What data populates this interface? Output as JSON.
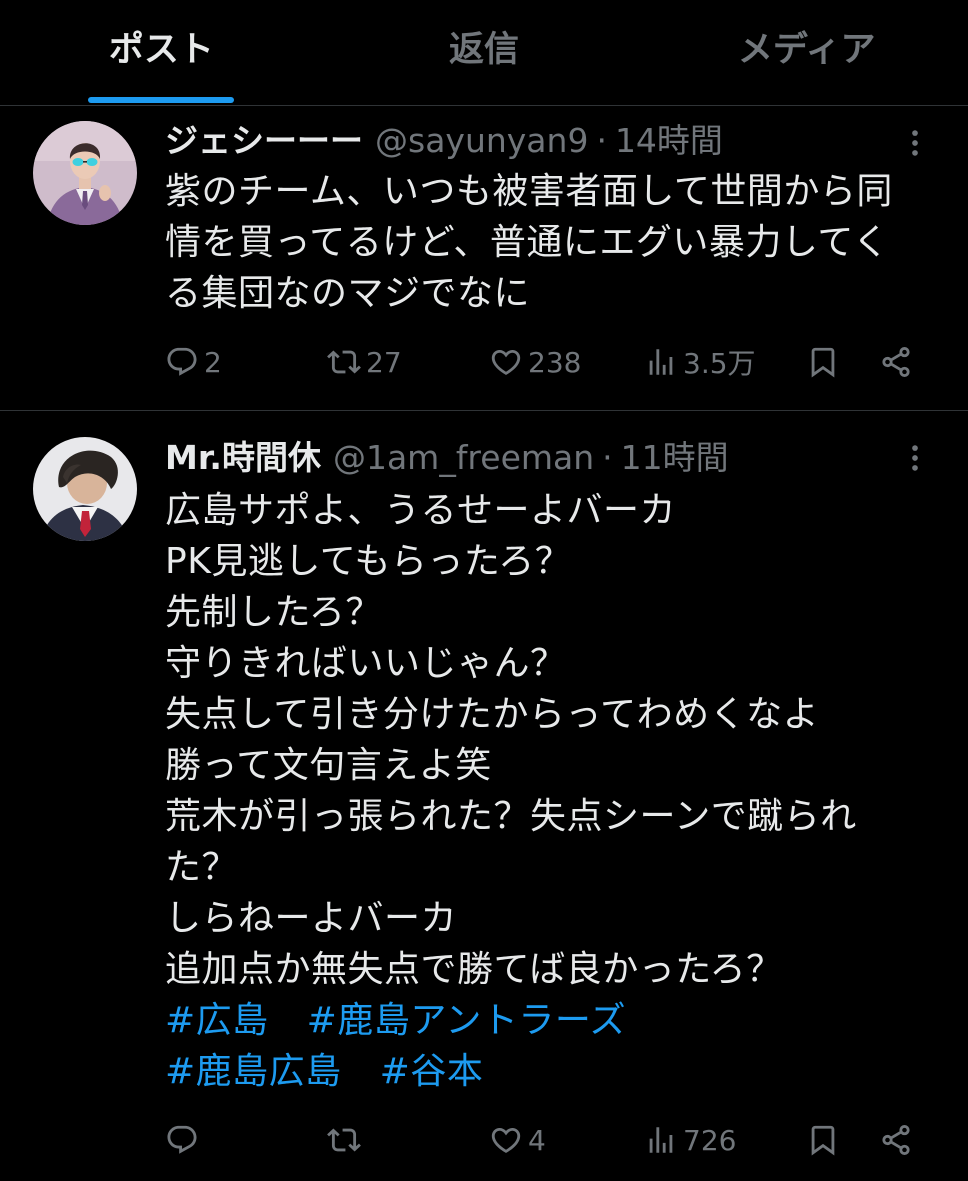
{
  "colors": {
    "background": "#000000",
    "text_primary": "#e7e9ea",
    "text_secondary": "#71767b",
    "accent": "#1d9bf0",
    "divider": "#2f3336"
  },
  "icons": {
    "reply": "reply-icon",
    "repost": "repost-icon",
    "like": "heart-icon",
    "views": "views-chart-icon",
    "bookmark": "bookmark-icon",
    "share": "share-icon",
    "more": "more-vertical-icon"
  },
  "tabs": [
    {
      "label": "ポスト",
      "active": true
    },
    {
      "label": "返信",
      "active": false
    },
    {
      "label": "メディア",
      "active": false
    }
  ],
  "posts": [
    {
      "display_name": "ジェシーーー",
      "handle": "@sayunyan9",
      "separator": "·",
      "time": "14時間",
      "text_lines": [
        "紫のチーム、いつも被害者面して世間から同",
        "情を買ってるけど、普通にエグい暴力してく",
        "る集団なのマジでなに"
      ],
      "stats": {
        "replies": "2",
        "reposts": "27",
        "likes": "238",
        "views": "3.5万"
      }
    },
    {
      "display_name": "Mr.時間休",
      "handle": "@1am_freeman",
      "separator": "·",
      "time": "11時間",
      "text_lines": [
        "広島サポよ、うるせーよバーカ",
        "PK見逃してもらったろ？",
        "先制したろ？",
        "守りきればいいじゃん？",
        "失点して引き分けたからってわめくなよ",
        "勝って文句言えよ笑",
        "荒木が引っ張られた？失点シーンで蹴られ",
        "た？",
        "しらねーよバーカ",
        "追加点か無失点で勝てば良かったろ？"
      ],
      "hashtag_lines": [
        [
          "#広島",
          "#鹿島アントラーズ"
        ],
        [
          "#鹿島広島",
          "#谷本"
        ]
      ],
      "stats": {
        "likes": "4",
        "views": "726"
      }
    }
  ]
}
